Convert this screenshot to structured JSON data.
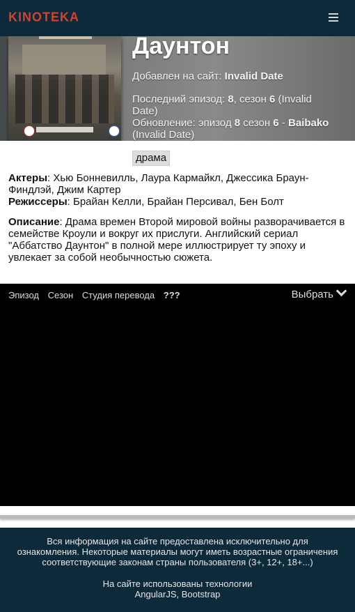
{
  "header": {
    "logo": "KINOTEKA"
  },
  "movie": {
    "title": "Даунтон",
    "added_label": "Добавлен на сайт:",
    "added_value": "Invalid Date",
    "last_episode_prefix": "Последний эпизод:",
    "last_episode_num": "8",
    "last_episode_season_label": ", сезон",
    "last_episode_season": "6",
    "last_episode_date": "(Invalid Date)",
    "update_prefix": "Обновление: эпизод",
    "update_episode": "8",
    "update_season_label": "сезон",
    "update_season": "6",
    "update_studio": "Baibako",
    "update_date": "(Invalid Date)",
    "genre": "драма",
    "actors_label": "Актеры",
    "actors": ": Хью Бонневилль, Лаура Кармайкл, Джессика Браун-Финдлэй, Джим Картер",
    "directors_label": "Режиссеры",
    "directors": ": Брайан Келли, Брайан Персивал, Бен Болт",
    "description_label": "Описание",
    "description": ": Драма времен Второй мировой войны разворачивается в семействе Кроули и вокруг их прислуги. Английский сериал \"Аббатство Даунтон\" в полной мере иллюстрирует ту эпоху и увлекает за собой необычностью сюжета."
  },
  "episodes": {
    "col_episode": "Эпизод",
    "col_season": "Сезон",
    "col_studio": "Студия перевода",
    "col_studio_value": "???",
    "choose_label": "Выбрать"
  },
  "footer": {
    "disclaimer": "Вся информация на сайте предоставлена исключительно для ознакомления. Некоторые материалы могут иметь возрастные ограничения соответствующие законам страны пользователя (3+, 12+, 18+...)",
    "tech": "На сайте использованы технологии AngularJS, Bootstrap"
  }
}
